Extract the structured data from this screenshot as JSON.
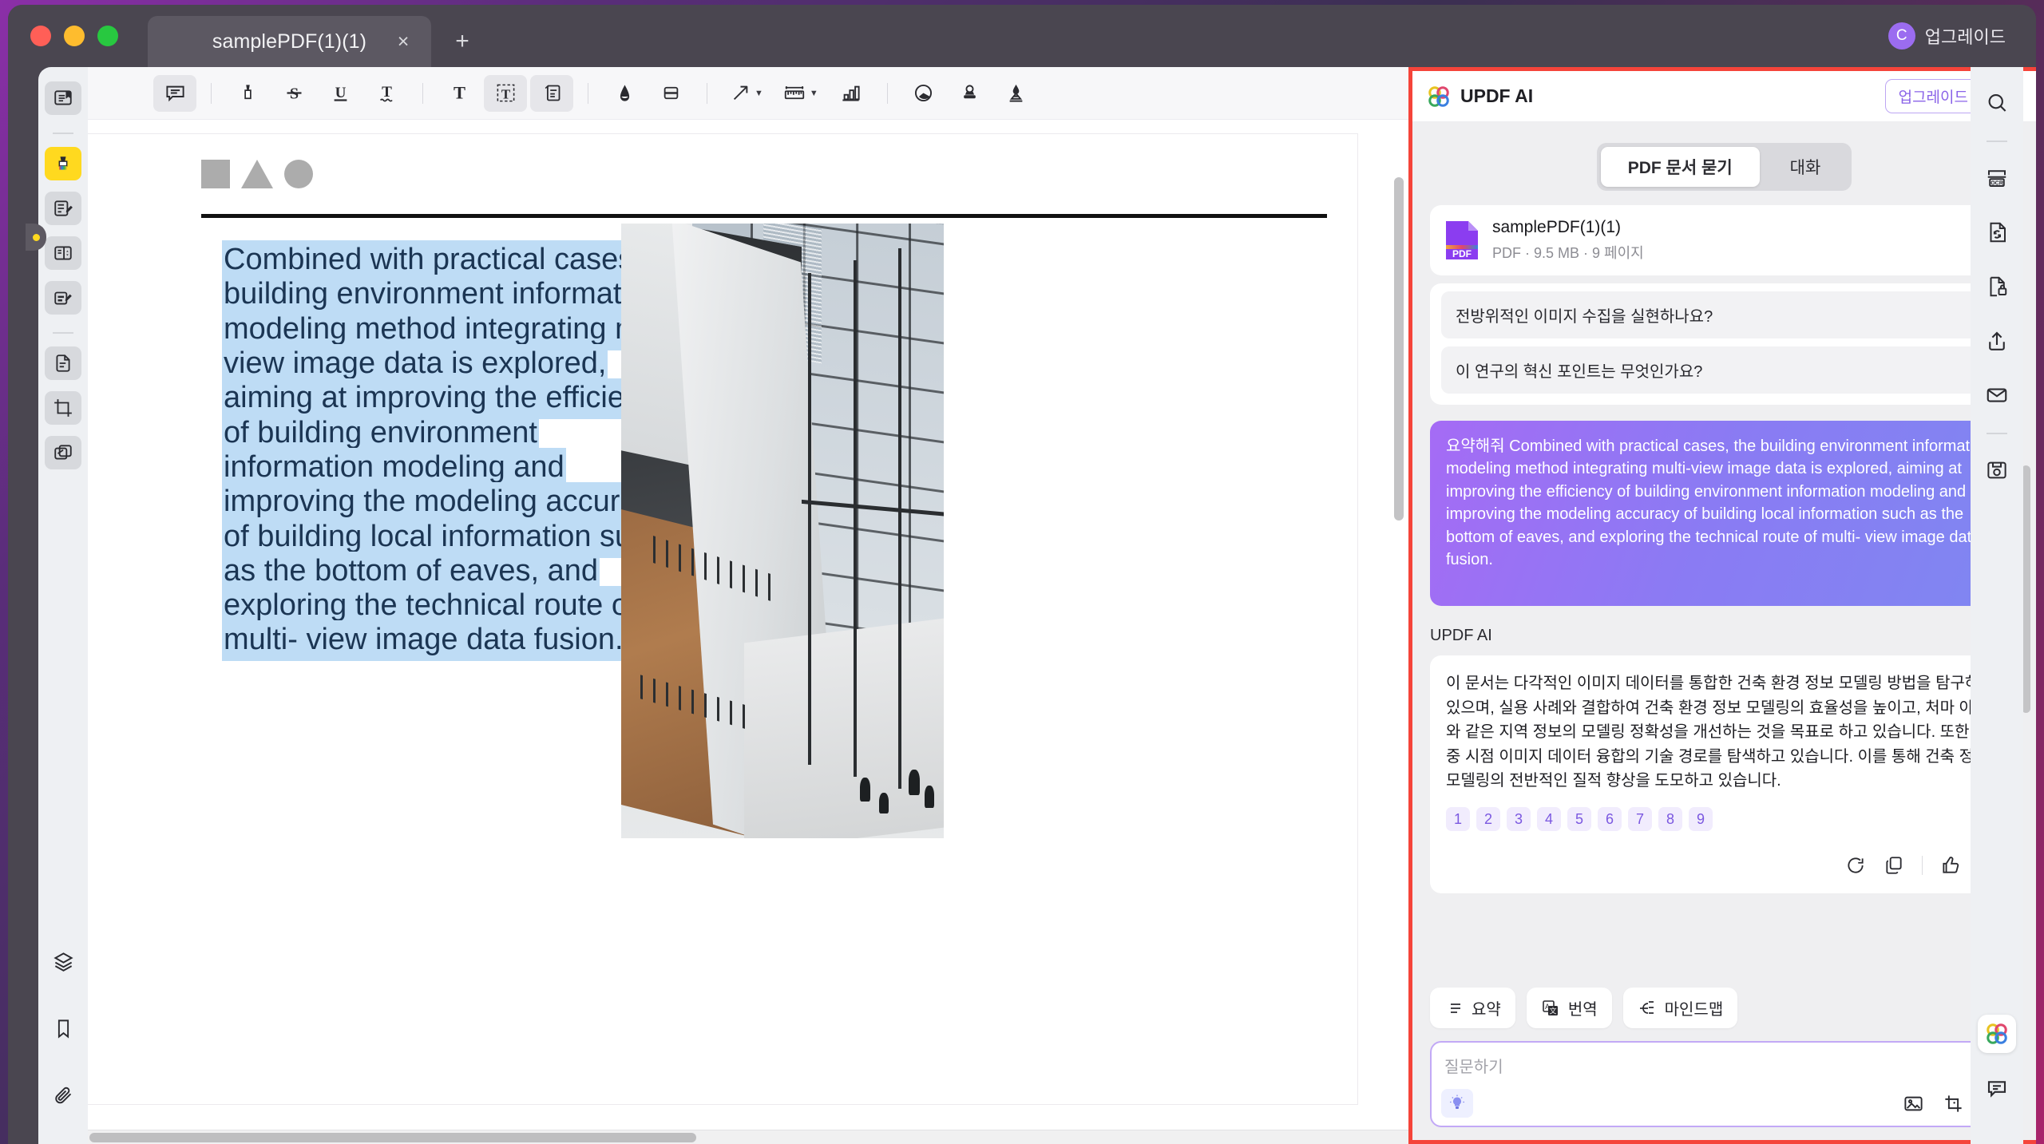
{
  "window": {
    "tab_title": "samplePDF(1)(1)",
    "new_tab_icon": "+",
    "close_icon": "×",
    "account_initial": "C",
    "account_label": "업그레이드"
  },
  "left_rail": {
    "items": [
      {
        "name": "reader-view",
        "icon": "reader-icon",
        "active": false
      },
      {
        "name": "highlight-tool",
        "icon": "highlighter-icon",
        "active": true
      },
      {
        "name": "annotate-tool",
        "icon": "annotate-icon",
        "active": false
      },
      {
        "name": "form-tool",
        "icon": "form-icon",
        "active": false
      },
      {
        "name": "edit-pdf-tool",
        "icon": "edit-pdf-icon",
        "active": false
      },
      {
        "name": "organize-pages",
        "icon": "pages-icon",
        "active": false
      },
      {
        "name": "crop-tool",
        "icon": "crop-icon",
        "active": false
      },
      {
        "name": "compare-tool",
        "icon": "compare-icon",
        "active": false
      }
    ],
    "bottom_items": [
      {
        "name": "layers",
        "icon": "layers-icon"
      },
      {
        "name": "bookmarks",
        "icon": "bookmark-icon"
      },
      {
        "name": "attachments",
        "icon": "paperclip-icon"
      }
    ]
  },
  "toolbar": {
    "items": [
      {
        "name": "note-comment",
        "icon": "comment-icon",
        "caret": false,
        "selected": true
      },
      {
        "name": "highlight",
        "icon": "marker-icon",
        "caret": false,
        "selected": false
      },
      {
        "name": "strikethrough",
        "icon": "strikethrough-icon",
        "caret": false,
        "selected": false
      },
      {
        "name": "underline",
        "icon": "underline-icon",
        "caret": false,
        "selected": false
      },
      {
        "name": "squiggly-underline",
        "icon": "squiggly-icon",
        "caret": false,
        "selected": false
      },
      {
        "name": "text-tool",
        "icon": "text-icon",
        "caret": false,
        "selected": false
      },
      {
        "name": "text-box",
        "icon": "textbox-icon",
        "caret": false,
        "selected": true
      },
      {
        "name": "sticky-note",
        "icon": "note-icon",
        "caret": false,
        "selected": true
      },
      {
        "name": "pencil",
        "icon": "pencil-icon",
        "caret": false,
        "selected": false
      },
      {
        "name": "eraser",
        "icon": "eraser-icon",
        "caret": false,
        "selected": false
      },
      {
        "name": "arrow-shape",
        "icon": "arrow-icon",
        "caret": true,
        "selected": false
      },
      {
        "name": "measure",
        "icon": "ruler-icon",
        "caret": true,
        "selected": false
      },
      {
        "name": "chart-annotation",
        "icon": "bar-chart-icon",
        "caret": false,
        "selected": false
      },
      {
        "name": "pie-annotation",
        "icon": "pie-icon",
        "caret": false,
        "selected": false
      },
      {
        "name": "stamp",
        "icon": "stamp-icon",
        "caret": false,
        "selected": false
      },
      {
        "name": "signature",
        "icon": "signature-icon",
        "caret": false,
        "selected": false
      }
    ]
  },
  "document": {
    "body_text": "Combined with practical cases, the building environment information modeling method integrating multi-view image data is explored, aiming at improving the efficiency of building environment information modeling and improving the modeling accuracy of building local information such as the bottom of eaves, and exploring the technical route of multi- view image data fusion.",
    "highlight_color": "#bedcf5",
    "shapes": [
      "square",
      "triangle",
      "circle"
    ]
  },
  "ai": {
    "title": "UPDF AI",
    "logo_icon": "updf-flower-icon",
    "upgrade_label": "업그레이드",
    "clear_icon": "broom-icon",
    "tabs": [
      {
        "label": "PDF 문서 묻기",
        "active": true
      },
      {
        "label": "대화",
        "active": false
      }
    ],
    "file": {
      "name": "samplePDF(1)(1)",
      "meta": "PDF · 9.5 MB · 9 페이지",
      "badge": "PDF"
    },
    "suggestions": [
      {
        "text": "전방위적인 이미지 수집을 실현하나요?",
        "arrow": "→"
      },
      {
        "text": "이 연구의 혁신 포인트는 무엇인가요?",
        "arrow": "→"
      }
    ],
    "user_message": "요약해줘 Combined with practical cases, the building environment information modeling method integrating multi-view image data is explored, aiming at improving the efficiency of building environment information modeling and improving the modeling accuracy of building local information such as the bottom of eaves, and exploring the technical route of multi- view image data fusion.",
    "edit_icon": "pencil-icon",
    "answer_label": "UPDF AI",
    "expand_icon": "external-link-icon",
    "answer_text": "이 문서는 다각적인 이미지 데이터를 통합한 건축 환경 정보 모델링 방법을 탐구하고 있으며, 실용 사례와 결합하여 건축 환경 정보 모델링의 효율성을 높이고, 처마 아래와 같은 지역 정보의 모델링 정확성을 개선하는 것을 목표로 하고 있습니다. 또한, 다중 시점 이미지 데이터 융합의 기술 경로를 탐색하고 있습니다. 이를 통해 건축 정보 모델링의 전반적인 질적 향상을 도모하고 있습니다.",
    "citations": [
      "1",
      "2",
      "3",
      "4",
      "5",
      "6",
      "7",
      "8",
      "9"
    ],
    "answer_actions": [
      {
        "name": "regenerate",
        "icon": "refresh-icon"
      },
      {
        "name": "copy",
        "icon": "copy-icon"
      },
      {
        "name": "thumbs-up",
        "icon": "thumbs-up-icon"
      },
      {
        "name": "thumbs-down",
        "icon": "thumbs-down-icon"
      }
    ],
    "quick_actions": [
      {
        "label": "요약",
        "icon": "summarize-icon"
      },
      {
        "label": "번역",
        "icon": "translate-icon"
      },
      {
        "label": "마인드맵",
        "icon": "mindmap-icon"
      }
    ],
    "composer": {
      "placeholder": "질문하기",
      "value": "",
      "bulb_icon": "lightbulb-icon",
      "image_icon": "image-icon",
      "screenshot_icon": "screenshot-icon",
      "send_icon": "send-icon"
    },
    "accent_color": "#8a63e8",
    "highlight_border_color": "#f5443a"
  },
  "right_rail": {
    "items": [
      {
        "name": "search",
        "icon": "search-icon"
      },
      {
        "name": "ocr",
        "icon": "ocr-icon"
      },
      {
        "name": "convert",
        "icon": "convert-icon"
      },
      {
        "name": "protect",
        "icon": "lock-document-icon"
      },
      {
        "name": "share",
        "icon": "share-icon"
      },
      {
        "name": "email",
        "icon": "mail-icon"
      },
      {
        "name": "save",
        "icon": "save-icon"
      }
    ],
    "bottom_items": [
      {
        "name": "updf-ai",
        "icon": "updf-flower-icon"
      },
      {
        "name": "feedback",
        "icon": "chat-bubble-icon"
      }
    ]
  }
}
